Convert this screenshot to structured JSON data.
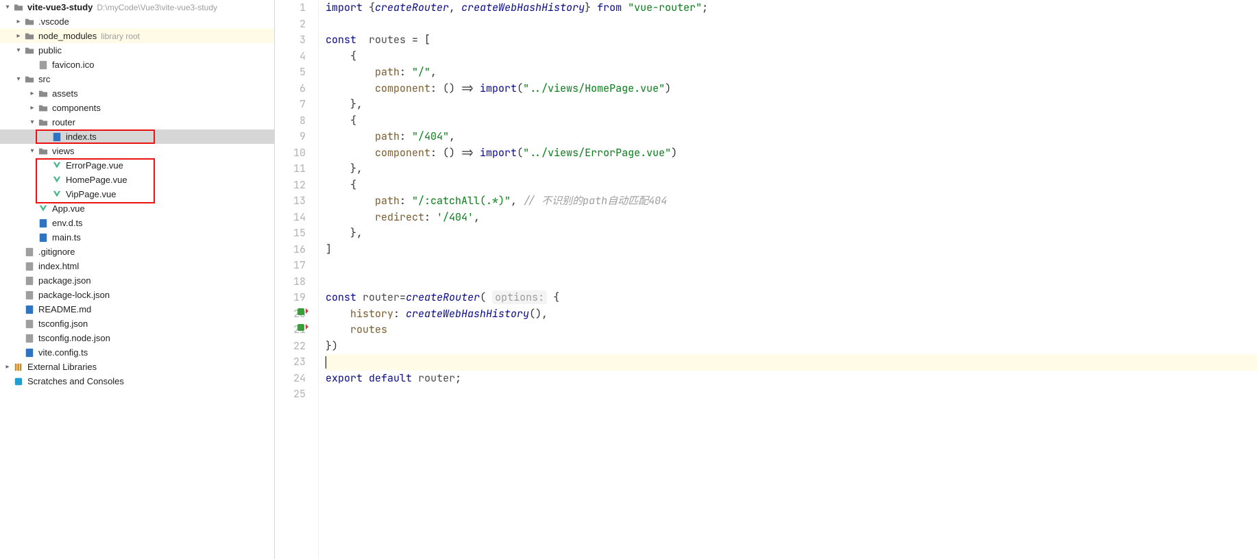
{
  "project": {
    "name": "vite-vue3-study",
    "path": "D:\\myCode\\Vue3\\vite-vue3-study"
  },
  "tree": {
    "vscode": ".vscode",
    "node_modules": "node_modules",
    "node_modules_suffix": "library root",
    "public": "public",
    "favicon": "favicon.ico",
    "src": "src",
    "assets": "assets",
    "components": "components",
    "router": "router",
    "index_ts": "index.ts",
    "views": "views",
    "errorpage": "ErrorPage.vue",
    "homepage": "HomePage.vue",
    "vippage": "VipPage.vue",
    "app_vue": "App.vue",
    "env_d_ts": "env.d.ts",
    "main_ts": "main.ts",
    "gitignore": ".gitignore",
    "index_html": "index.html",
    "package_json": "package.json",
    "package_lock": "package-lock.json",
    "readme": "README.md",
    "tsconfig": "tsconfig.json",
    "tsconfig_node": "tsconfig.node.json",
    "vite_config": "vite.config.ts",
    "ext_libs": "External Libraries",
    "scratches": "Scratches and Consoles"
  },
  "code": {
    "l1": {
      "a": "import",
      "b": " {",
      "c": "createRouter",
      "d": ", ",
      "e": "createWebHashHistory",
      "f": "} ",
      "g": "from",
      "h": " ",
      "i": "\"vue-router\"",
      "j": ";"
    },
    "l3": {
      "a": "const",
      "b": "  ",
      "c": "routes",
      "d": " = ["
    },
    "l4": "    {",
    "l5": {
      "a": "        ",
      "b": "path",
      "c": ": ",
      "d": "\"/\"",
      "e": ","
    },
    "l6": {
      "a": "        ",
      "b": "component",
      "c": ": () => ",
      "d": "import",
      "e": "(",
      "f": "\"../views/HomePage.vue\"",
      "g": ")"
    },
    "l7": "    },",
    "l8": "    {",
    "l9": {
      "a": "        ",
      "b": "path",
      "c": ": ",
      "d": "\"/404\"",
      "e": ","
    },
    "l10": {
      "a": "        ",
      "b": "component",
      "c": ": () => ",
      "d": "import",
      "e": "(",
      "f": "\"../views/ErrorPage.vue\"",
      "g": ")"
    },
    "l11": "    },",
    "l12": "    {",
    "l13": {
      "a": "        ",
      "b": "path",
      "c": ": ",
      "d": "\"/:catchAll(.*)\"",
      "e": ", ",
      "f": "// 不识别的path自动匹配404"
    },
    "l14": {
      "a": "        ",
      "b": "redirect",
      "c": ": ",
      "d": "'/404'",
      "e": ","
    },
    "l15": "    },",
    "l16": "]",
    "l19": {
      "a": "const",
      "b": " ",
      "c": "router",
      "d": "=",
      "e": "createRouter",
      "f": "( ",
      "g": "options:",
      "h": " {"
    },
    "l20": {
      "a": "    ",
      "b": "history",
      "c": ": ",
      "d": "createWebHashHistory",
      "e": "(),"
    },
    "l21": {
      "a": "    ",
      "b": "routes"
    },
    "l22": "})",
    "l24": {
      "a": "export",
      "b": " ",
      "c": "default",
      "d": " ",
      "e": "router",
      "f": ";"
    }
  },
  "line_numbers": [
    "1",
    "2",
    "3",
    "4",
    "5",
    "6",
    "7",
    "8",
    "9",
    "10",
    "11",
    "12",
    "13",
    "14",
    "15",
    "16",
    "17",
    "18",
    "19",
    "20",
    "21",
    "22",
    "23",
    "24",
    "25"
  ]
}
